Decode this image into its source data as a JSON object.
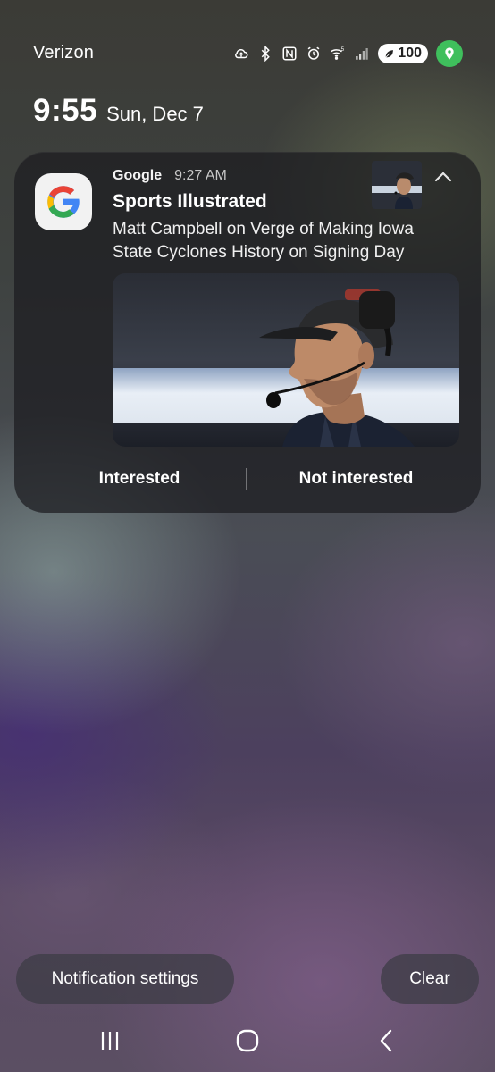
{
  "status_bar": {
    "carrier": "Verizon",
    "network_label": "5",
    "battery": "100",
    "icons": [
      "cloud-sync-icon",
      "bluetooth-icon",
      "nfc-icon",
      "alarm-icon",
      "wifi-5-icon",
      "signal-icon",
      "battery-saver-leaf-icon",
      "location-icon"
    ],
    "location_color": "#3fbf5c"
  },
  "lock_clock": {
    "time": "9:55",
    "date": "Sun, Dec 7"
  },
  "notification": {
    "app_name": "Google",
    "time": "9:27 AM",
    "title": "Sports Illustrated",
    "text": "Matt Campbell on Verge of Making Iowa State Cyclones History on Signing Day",
    "actions": {
      "positive": "Interested",
      "negative": "Not interested"
    },
    "icons": [
      "google-g-icon",
      "chevron-up-icon"
    ]
  },
  "bottom_actions": {
    "settings": "Notification settings",
    "clear": "Clear"
  },
  "nav_bar": {
    "icons": [
      "recents-icon",
      "home-icon",
      "back-icon"
    ]
  }
}
